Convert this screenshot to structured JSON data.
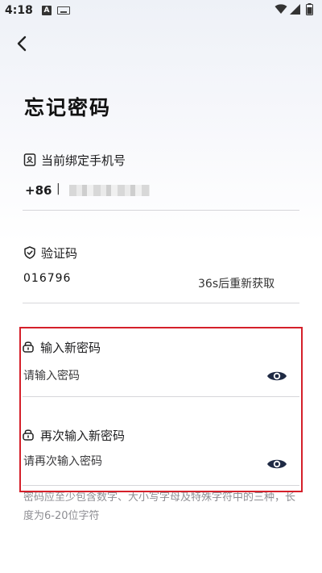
{
  "status_bar": {
    "time": "4:18",
    "notification_icon": "A",
    "icons": [
      "keyboard-icon",
      "wifi-icon",
      "signal-icon",
      "battery-icon"
    ]
  },
  "nav": {
    "back_icon": "chevron-left-icon"
  },
  "page": {
    "title": "忘记密码"
  },
  "phone": {
    "label": "当前绑定手机号",
    "country_code": "+86",
    "separator": "|"
  },
  "verify": {
    "label": "验证码",
    "code": "016796",
    "resend": "36s后重新获取"
  },
  "new_password": {
    "label": "输入新密码",
    "placeholder": "请输入密码"
  },
  "confirm_password": {
    "label": "再次输入新密码",
    "placeholder": "请再次输入密码"
  },
  "hint": "密码应至少包含数字、大小写字母及特殊字符中的三种，长度为6-20位字符",
  "colors": {
    "highlight": "#d5202a",
    "eye_icon": "#1f2a44",
    "hint_text": "#8e8e93"
  }
}
